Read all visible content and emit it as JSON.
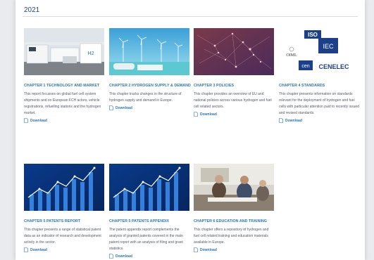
{
  "year": "2021",
  "colors": {
    "link": "#2a75b5",
    "text": "#555b63",
    "heading": "#2b4a73"
  },
  "cards": [
    {
      "title": "CHAPTER 1 TECHNOLOGY AND MARKET",
      "description": "This report focusses on global fuel cell system shipments and on European FCH actors, vehicle registrations, refuelling stations and the hydrogen market.",
      "download": "Download"
    },
    {
      "title": "CHAPTER 2 HYDROGEN SUPPLY & DEMAND",
      "description": "This chapter tracks changes in the structure of hydrogen supply and demand in Europe.",
      "download": "Download"
    },
    {
      "title": "CHAPTER 3 POLICIES",
      "description": "This chapter provides an overview of EU and national policies across various hydrogen and fuel cell related sectors.",
      "download": "Download"
    },
    {
      "title": "CHAPTER 4 STANDARDS",
      "description": "This chapter presents information on standards relevant for the deployment of hydrogen and fuel cells with particular attention paid to recently issued and revised standards.",
      "download": "Download",
      "logos": {
        "iso": "ISO",
        "iec": "IEC",
        "oiml": "OIML",
        "cen": "cen",
        "cenelec": "CENELEC"
      }
    },
    {
      "title": "CHAPTER 5 PATENTS REPORT",
      "description": "This chapter presents a range of statistical patent data as an indicator of research and development activity in the sector.",
      "download": "Download"
    },
    {
      "title": "CHAPTER 5 PATENTS APPENDIX",
      "description": "The patent appendix report complements the analysis of granted patents covered in the main patent report with an analysis of filing and grant statistics.",
      "download": "Download"
    },
    {
      "title": "CHAPTER 6 EDUCATION AND TRAINING",
      "description": "This chapter offers a repository of hydrogen and fuel cell related training and education materials available in Europe.",
      "download": "Download"
    }
  ]
}
